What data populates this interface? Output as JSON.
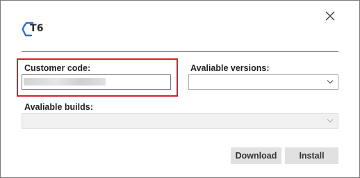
{
  "header": {
    "logo_text": "T6",
    "logo_icon": "hexagon-logo-icon",
    "close_icon": "close-icon"
  },
  "form": {
    "customer_code_label": "Customer code:",
    "customer_code_value": "",
    "versions_label": "Avaliable versions:",
    "versions_selected": "",
    "builds_label": "Avaliable builds:",
    "builds_selected": ""
  },
  "actions": {
    "download_label": "Download",
    "install_label": "Install"
  },
  "colors": {
    "highlight": "#d3202a",
    "logo_accent": "#2f6fd6"
  }
}
